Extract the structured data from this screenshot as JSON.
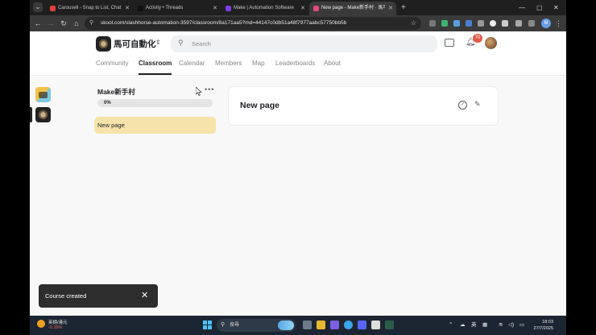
{
  "browser": {
    "tabs": [
      {
        "title": "Carousell - Snap to List, Chat",
        "favicon_color": "#e0403a",
        "active": false
      },
      {
        "title": "Activity • Threads",
        "favicon_color": "#111111",
        "active": false
      },
      {
        "title": "Make | Automation Software",
        "favicon_color": "#7b3fe4",
        "active": false
      },
      {
        "title": "New page - Make新手村 · 馬可",
        "favicon_color": "#e04a7a",
        "active": true
      }
    ],
    "new_tab_label": "+",
    "window_controls": {
      "minimize": "—",
      "maximize": "▢",
      "close": "✕"
    },
    "url": "skool.com/slashhorse-automation-3597/classroom/8a171aa5?md=44147c0db51a48f7977aabc57750bb5b",
    "profile_initial": "M"
  },
  "header": {
    "group_name": "馬可自動化",
    "switcher_icon": "⇕",
    "search_placeholder": "Search",
    "notification_count": "70",
    "nav_tabs": [
      {
        "label": "Community",
        "active": false
      },
      {
        "label": "Classroom",
        "active": true
      },
      {
        "label": "Calendar",
        "active": false
      },
      {
        "label": "Members",
        "active": false
      },
      {
        "label": "Map",
        "active": false
      },
      {
        "label": "Leaderboards",
        "active": false
      },
      {
        "label": "About",
        "active": false
      }
    ]
  },
  "course": {
    "title": "Make新手村",
    "menu_label": "•••",
    "progress_percent": 0,
    "progress_label": "0%",
    "lessons": [
      {
        "title": "New page",
        "selected": true
      }
    ]
  },
  "content": {
    "page_title": "New page"
  },
  "toast": {
    "message": "Course created",
    "close_label": "✕"
  },
  "taskbar": {
    "weather_line1": "英鎊/港元",
    "weather_line2": "-0.38%",
    "search_placeholder": "搜尋",
    "lang_label": "英",
    "time": "18:03",
    "date": "27/7/2025"
  }
}
